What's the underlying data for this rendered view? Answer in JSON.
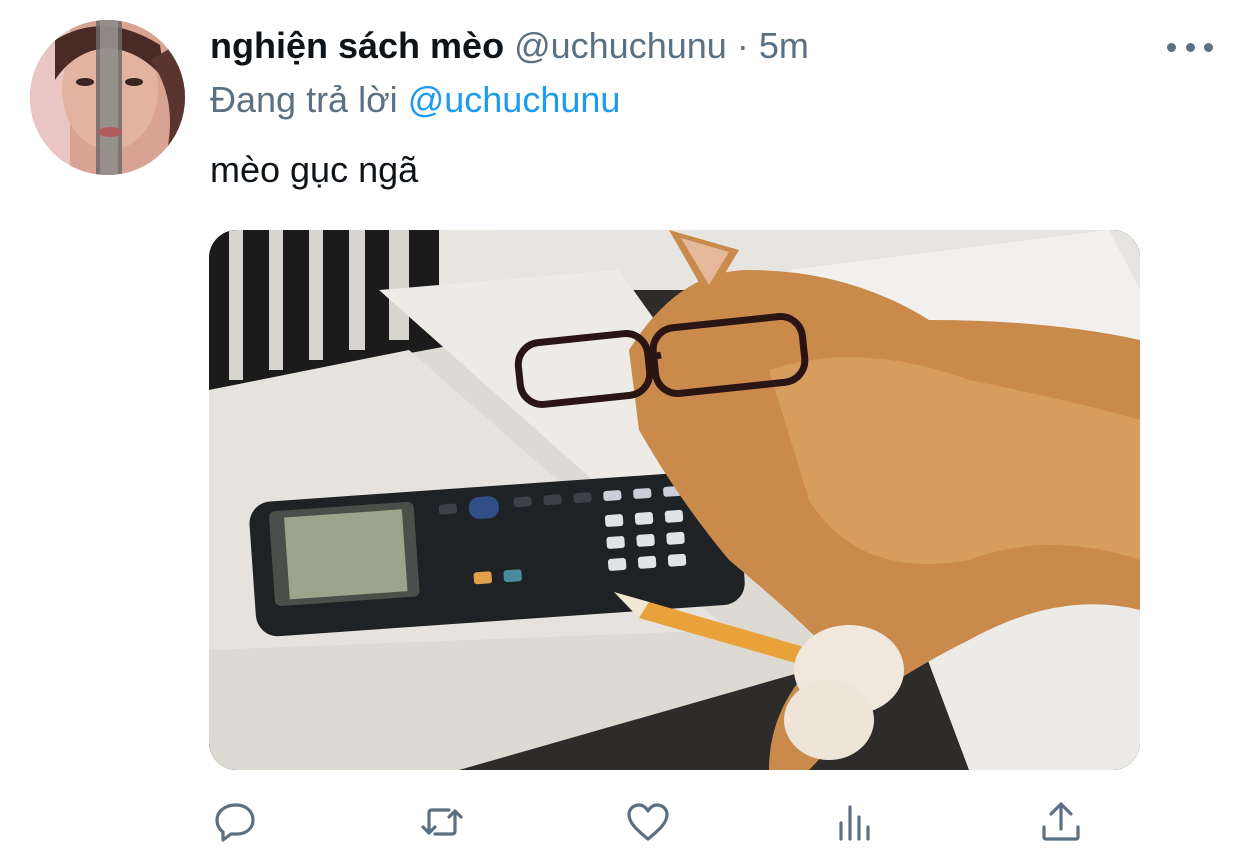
{
  "tweet": {
    "display_name": "nghiện sách mèo",
    "handle": "@uchuchunu",
    "separator": "·",
    "time": "5m",
    "reply_prefix": "Đang trả lời",
    "reply_to": "@uchuchunu",
    "text": "mèo gục ngã"
  },
  "icons": {
    "more": "more-horizontal-icon",
    "reply": "reply-bubble-icon",
    "retweet": "retweet-icon",
    "like": "heart-icon",
    "analytics": "analytics-bars-icon",
    "share": "share-upload-icon"
  },
  "colors": {
    "text_primary": "#0f1419",
    "text_secondary": "#5b7083",
    "link": "#1d9bf0",
    "background": "#ffffff"
  }
}
